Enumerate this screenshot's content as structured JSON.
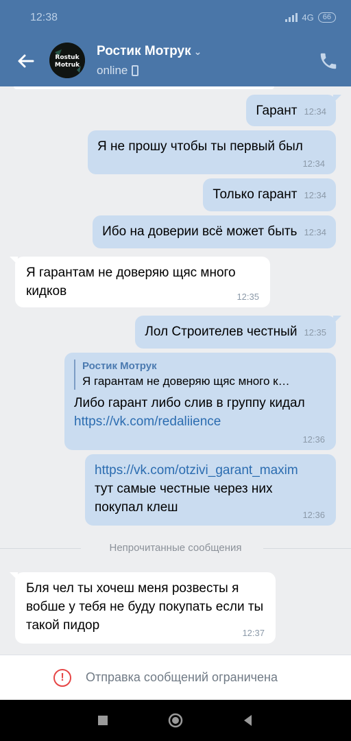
{
  "status_bar": {
    "time": "12:38",
    "network": "4G",
    "battery": "66"
  },
  "header": {
    "contact_name": "Ростик Мотрук",
    "status": "online",
    "avatar_text_line1": "Rostuk",
    "avatar_text_line2": "Motruk"
  },
  "messages": [
    {
      "direction": "out",
      "text": "Гарант",
      "time": "12:34"
    },
    {
      "direction": "out",
      "text": "Я не прошу чтобы ты первый был",
      "time": "12:34"
    },
    {
      "direction": "out",
      "text": "Только гарант",
      "time": "12:34"
    },
    {
      "direction": "out",
      "text": "Ибо на доверии всё может быть",
      "time": "12:34"
    },
    {
      "direction": "in",
      "text": "Я гарантам не доверяю щяс много кидков",
      "time": "12:35"
    },
    {
      "direction": "out",
      "text": "Лол Строителев честный",
      "time": "12:35"
    },
    {
      "direction": "out",
      "quote_author": "Ростик Мотрук",
      "quote_text": "Я гарантам не доверяю щяс много к…",
      "text": "Либо гарант либо слив в группу кидал",
      "link": "https://vk.com/redaliience",
      "time": "12:36"
    },
    {
      "direction": "out",
      "link": "https://vk.com/otzivi_garant_maxim",
      "text": "тут самые честные через них покупал клеш",
      "time": "12:36"
    },
    {
      "direction": "in",
      "text": "Бля чел ты хочеш меня розвесты я вобше у тебя не буду покупать если ты такой пидор",
      "time": "12:37"
    }
  ],
  "unread_divider": "Непрочитанные сообщения",
  "restriction": {
    "text": "Отправка сообщений ограничена"
  },
  "icons": {
    "back": "arrow-left-icon",
    "call": "phone-icon",
    "warning": "exclamation-circle-icon",
    "nav_recents": "square-icon",
    "nav_home": "circle-icon",
    "nav_back": "triangle-icon"
  },
  "colors": {
    "header": "#4a76a8",
    "outgoing_bubble": "#cadcf0",
    "incoming_bubble": "#ffffff",
    "warning": "#e64646",
    "link": "#2b6cb0"
  }
}
